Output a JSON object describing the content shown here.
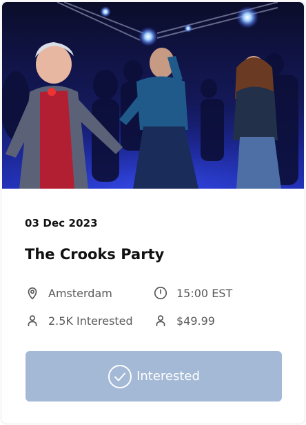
{
  "event": {
    "date": "03 Dec 2023",
    "title": "The Crooks Party",
    "location": "Amsterdam",
    "time": "15:00 EST",
    "interested": "2.5K Interested",
    "price": "$49.99"
  },
  "button": {
    "label": "Interested"
  },
  "icons": {
    "location": "location-pin-icon",
    "time": "clock-icon",
    "interested": "user-icon",
    "price": "user-icon",
    "button": "check-circle-icon"
  },
  "colors": {
    "button_bg": "#a4b9d6",
    "text_dark": "#111111",
    "text_muted": "#5a5a5a"
  }
}
